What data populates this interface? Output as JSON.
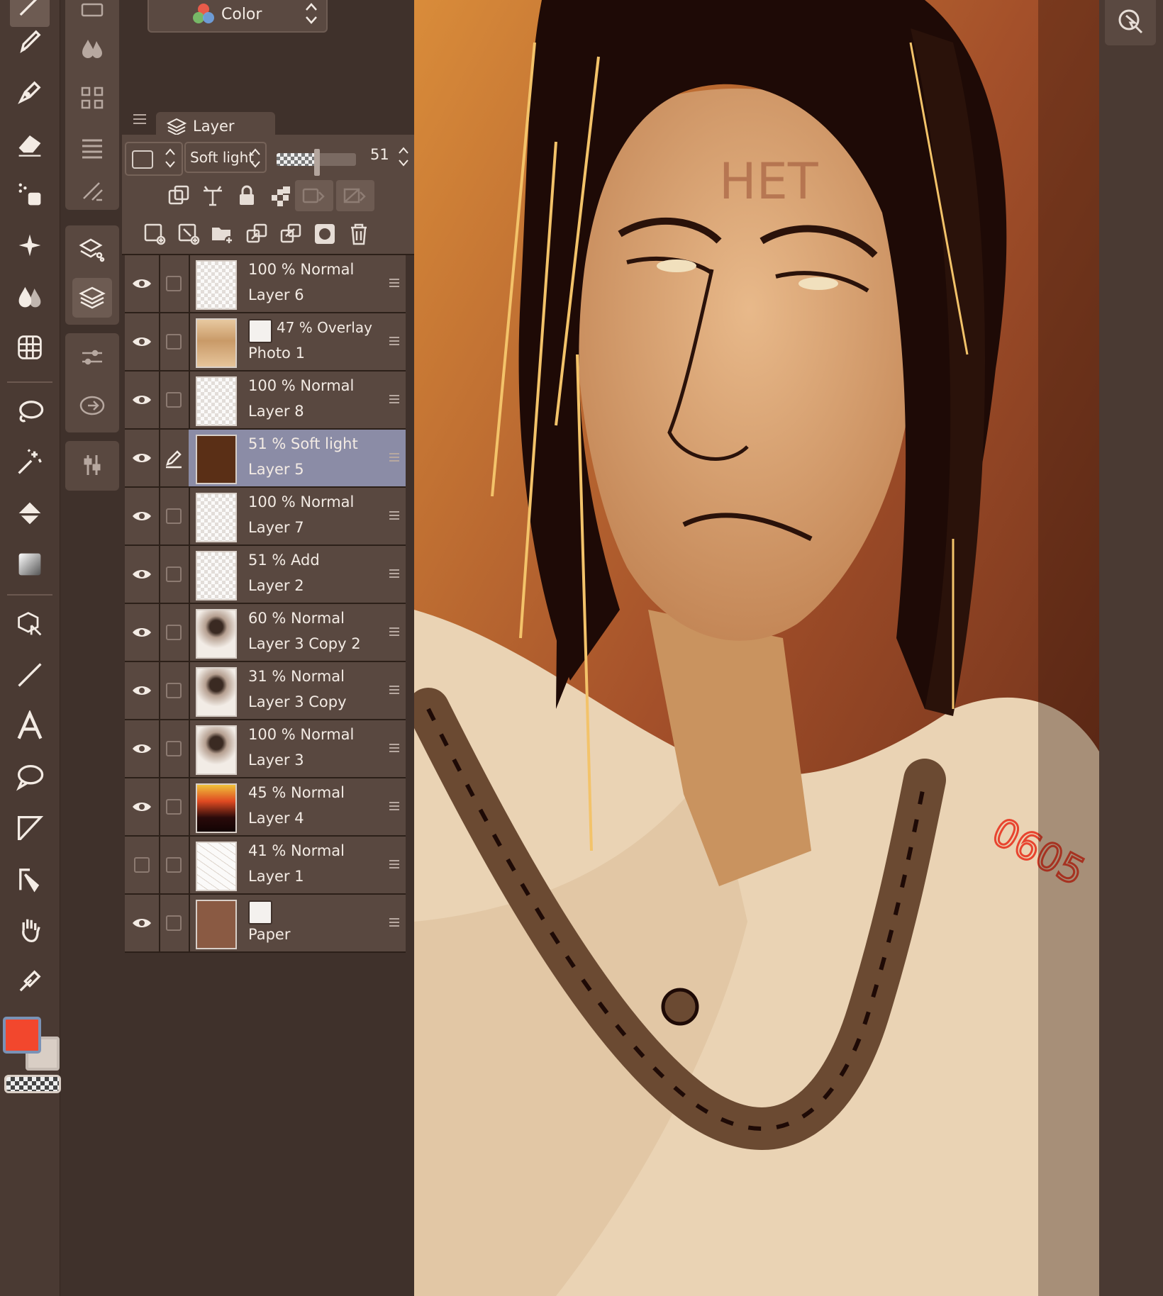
{
  "colors": {
    "panel": "#594840",
    "background": "#3f312b",
    "selected_row": "#8b8ca6",
    "main_color": "#f2472d",
    "sub_color": "#d9cec5"
  },
  "tools": [
    "pen-tool-icon",
    "pencil-tool-icon",
    "eraser-tool-icon",
    "blend-tool-icon",
    "decoration-tool-icon",
    "fill-drop-icon",
    "mesh-transform-icon",
    "lasso-select-icon",
    "magic-wand-icon",
    "fill-bucket-icon",
    "gradient-icon",
    "object-select-icon",
    "line-tool-icon",
    "text-tool-icon",
    "balloon-icon",
    "frame-border-icon",
    "ruler-tool-icon",
    "hand-tool-icon",
    "eyedropper-icon"
  ],
  "color_set": {
    "label": "Color"
  },
  "layer_panel": {
    "tab_label": "Layer",
    "blend_mode": "Soft light",
    "opacity": "51",
    "opacity_fraction": 0.51
  },
  "layers": [
    {
      "opacity_mode": "100 %  Normal",
      "name": "Layer 6",
      "visible": true,
      "selected": false,
      "thumb": "checker"
    },
    {
      "opacity_mode": "47 %  Overlay",
      "name": "Photo 1",
      "visible": true,
      "selected": false,
      "thumb": "photo",
      "has_icon": true
    },
    {
      "opacity_mode": "100 %  Normal",
      "name": "Layer 8",
      "visible": true,
      "selected": false,
      "thumb": "checker"
    },
    {
      "opacity_mode": "51 %  Soft light",
      "name": "Layer 5",
      "visible": true,
      "selected": true,
      "thumb": "brown"
    },
    {
      "opacity_mode": "100 %  Normal",
      "name": "Layer 7",
      "visible": true,
      "selected": false,
      "thumb": "checker"
    },
    {
      "opacity_mode": "51 %  Add",
      "name": "Layer 2",
      "visible": true,
      "selected": false,
      "thumb": "checker"
    },
    {
      "opacity_mode": "60 %  Normal",
      "name": "Layer 3 Copy 2",
      "visible": true,
      "selected": false,
      "thumb": "sketch"
    },
    {
      "opacity_mode": "31 %  Normal",
      "name": "Layer 3 Copy",
      "visible": true,
      "selected": false,
      "thumb": "sketch"
    },
    {
      "opacity_mode": "100 %  Normal",
      "name": "Layer 3",
      "visible": true,
      "selected": false,
      "thumb": "sketch"
    },
    {
      "opacity_mode": "45 %  Normal",
      "name": "Layer 4",
      "visible": true,
      "selected": false,
      "thumb": "gradient"
    },
    {
      "opacity_mode": "41 %  Normal",
      "name": "Layer 1",
      "visible": false,
      "selected": false,
      "thumb": "lines"
    },
    {
      "opacity_mode": "",
      "name": "Paper",
      "visible": true,
      "selected": false,
      "thumb": "paper",
      "has_icon": true
    }
  ],
  "canvas": {
    "signature": "0605",
    "forehead_text": "HET"
  }
}
